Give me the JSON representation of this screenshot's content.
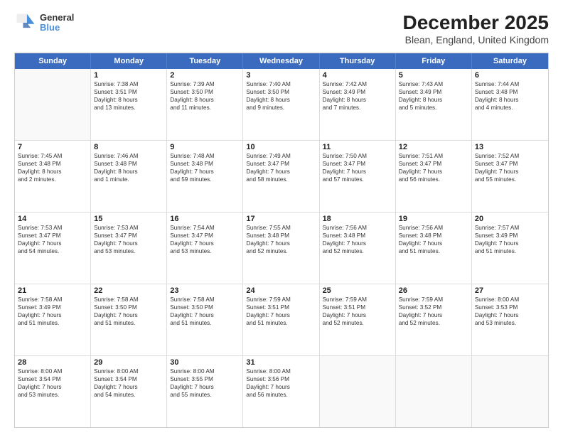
{
  "logo": {
    "line1": "General",
    "line2": "Blue"
  },
  "title": "December 2025",
  "subtitle": "Blean, England, United Kingdom",
  "weekdays": [
    "Sunday",
    "Monday",
    "Tuesday",
    "Wednesday",
    "Thursday",
    "Friday",
    "Saturday"
  ],
  "weeks": [
    [
      {
        "day": "",
        "lines": []
      },
      {
        "day": "1",
        "lines": [
          "Sunrise: 7:38 AM",
          "Sunset: 3:51 PM",
          "Daylight: 8 hours",
          "and 13 minutes."
        ]
      },
      {
        "day": "2",
        "lines": [
          "Sunrise: 7:39 AM",
          "Sunset: 3:50 PM",
          "Daylight: 8 hours",
          "and 11 minutes."
        ]
      },
      {
        "day": "3",
        "lines": [
          "Sunrise: 7:40 AM",
          "Sunset: 3:50 PM",
          "Daylight: 8 hours",
          "and 9 minutes."
        ]
      },
      {
        "day": "4",
        "lines": [
          "Sunrise: 7:42 AM",
          "Sunset: 3:49 PM",
          "Daylight: 8 hours",
          "and 7 minutes."
        ]
      },
      {
        "day": "5",
        "lines": [
          "Sunrise: 7:43 AM",
          "Sunset: 3:49 PM",
          "Daylight: 8 hours",
          "and 5 minutes."
        ]
      },
      {
        "day": "6",
        "lines": [
          "Sunrise: 7:44 AM",
          "Sunset: 3:48 PM",
          "Daylight: 8 hours",
          "and 4 minutes."
        ]
      }
    ],
    [
      {
        "day": "7",
        "lines": [
          "Sunrise: 7:45 AM",
          "Sunset: 3:48 PM",
          "Daylight: 8 hours",
          "and 2 minutes."
        ]
      },
      {
        "day": "8",
        "lines": [
          "Sunrise: 7:46 AM",
          "Sunset: 3:48 PM",
          "Daylight: 8 hours",
          "and 1 minute."
        ]
      },
      {
        "day": "9",
        "lines": [
          "Sunrise: 7:48 AM",
          "Sunset: 3:48 PM",
          "Daylight: 7 hours",
          "and 59 minutes."
        ]
      },
      {
        "day": "10",
        "lines": [
          "Sunrise: 7:49 AM",
          "Sunset: 3:47 PM",
          "Daylight: 7 hours",
          "and 58 minutes."
        ]
      },
      {
        "day": "11",
        "lines": [
          "Sunrise: 7:50 AM",
          "Sunset: 3:47 PM",
          "Daylight: 7 hours",
          "and 57 minutes."
        ]
      },
      {
        "day": "12",
        "lines": [
          "Sunrise: 7:51 AM",
          "Sunset: 3:47 PM",
          "Daylight: 7 hours",
          "and 56 minutes."
        ]
      },
      {
        "day": "13",
        "lines": [
          "Sunrise: 7:52 AM",
          "Sunset: 3:47 PM",
          "Daylight: 7 hours",
          "and 55 minutes."
        ]
      }
    ],
    [
      {
        "day": "14",
        "lines": [
          "Sunrise: 7:53 AM",
          "Sunset: 3:47 PM",
          "Daylight: 7 hours",
          "and 54 minutes."
        ]
      },
      {
        "day": "15",
        "lines": [
          "Sunrise: 7:53 AM",
          "Sunset: 3:47 PM",
          "Daylight: 7 hours",
          "and 53 minutes."
        ]
      },
      {
        "day": "16",
        "lines": [
          "Sunrise: 7:54 AM",
          "Sunset: 3:47 PM",
          "Daylight: 7 hours",
          "and 53 minutes."
        ]
      },
      {
        "day": "17",
        "lines": [
          "Sunrise: 7:55 AM",
          "Sunset: 3:48 PM",
          "Daylight: 7 hours",
          "and 52 minutes."
        ]
      },
      {
        "day": "18",
        "lines": [
          "Sunrise: 7:56 AM",
          "Sunset: 3:48 PM",
          "Daylight: 7 hours",
          "and 52 minutes."
        ]
      },
      {
        "day": "19",
        "lines": [
          "Sunrise: 7:56 AM",
          "Sunset: 3:48 PM",
          "Daylight: 7 hours",
          "and 51 minutes."
        ]
      },
      {
        "day": "20",
        "lines": [
          "Sunrise: 7:57 AM",
          "Sunset: 3:49 PM",
          "Daylight: 7 hours",
          "and 51 minutes."
        ]
      }
    ],
    [
      {
        "day": "21",
        "lines": [
          "Sunrise: 7:58 AM",
          "Sunset: 3:49 PM",
          "Daylight: 7 hours",
          "and 51 minutes."
        ]
      },
      {
        "day": "22",
        "lines": [
          "Sunrise: 7:58 AM",
          "Sunset: 3:50 PM",
          "Daylight: 7 hours",
          "and 51 minutes."
        ]
      },
      {
        "day": "23",
        "lines": [
          "Sunrise: 7:58 AM",
          "Sunset: 3:50 PM",
          "Daylight: 7 hours",
          "and 51 minutes."
        ]
      },
      {
        "day": "24",
        "lines": [
          "Sunrise: 7:59 AM",
          "Sunset: 3:51 PM",
          "Daylight: 7 hours",
          "and 51 minutes."
        ]
      },
      {
        "day": "25",
        "lines": [
          "Sunrise: 7:59 AM",
          "Sunset: 3:51 PM",
          "Daylight: 7 hours",
          "and 52 minutes."
        ]
      },
      {
        "day": "26",
        "lines": [
          "Sunrise: 7:59 AM",
          "Sunset: 3:52 PM",
          "Daylight: 7 hours",
          "and 52 minutes."
        ]
      },
      {
        "day": "27",
        "lines": [
          "Sunrise: 8:00 AM",
          "Sunset: 3:53 PM",
          "Daylight: 7 hours",
          "and 53 minutes."
        ]
      }
    ],
    [
      {
        "day": "28",
        "lines": [
          "Sunrise: 8:00 AM",
          "Sunset: 3:54 PM",
          "Daylight: 7 hours",
          "and 53 minutes."
        ]
      },
      {
        "day": "29",
        "lines": [
          "Sunrise: 8:00 AM",
          "Sunset: 3:54 PM",
          "Daylight: 7 hours",
          "and 54 minutes."
        ]
      },
      {
        "day": "30",
        "lines": [
          "Sunrise: 8:00 AM",
          "Sunset: 3:55 PM",
          "Daylight: 7 hours",
          "and 55 minutes."
        ]
      },
      {
        "day": "31",
        "lines": [
          "Sunrise: 8:00 AM",
          "Sunset: 3:56 PM",
          "Daylight: 7 hours",
          "and 56 minutes."
        ]
      },
      {
        "day": "",
        "lines": []
      },
      {
        "day": "",
        "lines": []
      },
      {
        "day": "",
        "lines": []
      }
    ]
  ]
}
